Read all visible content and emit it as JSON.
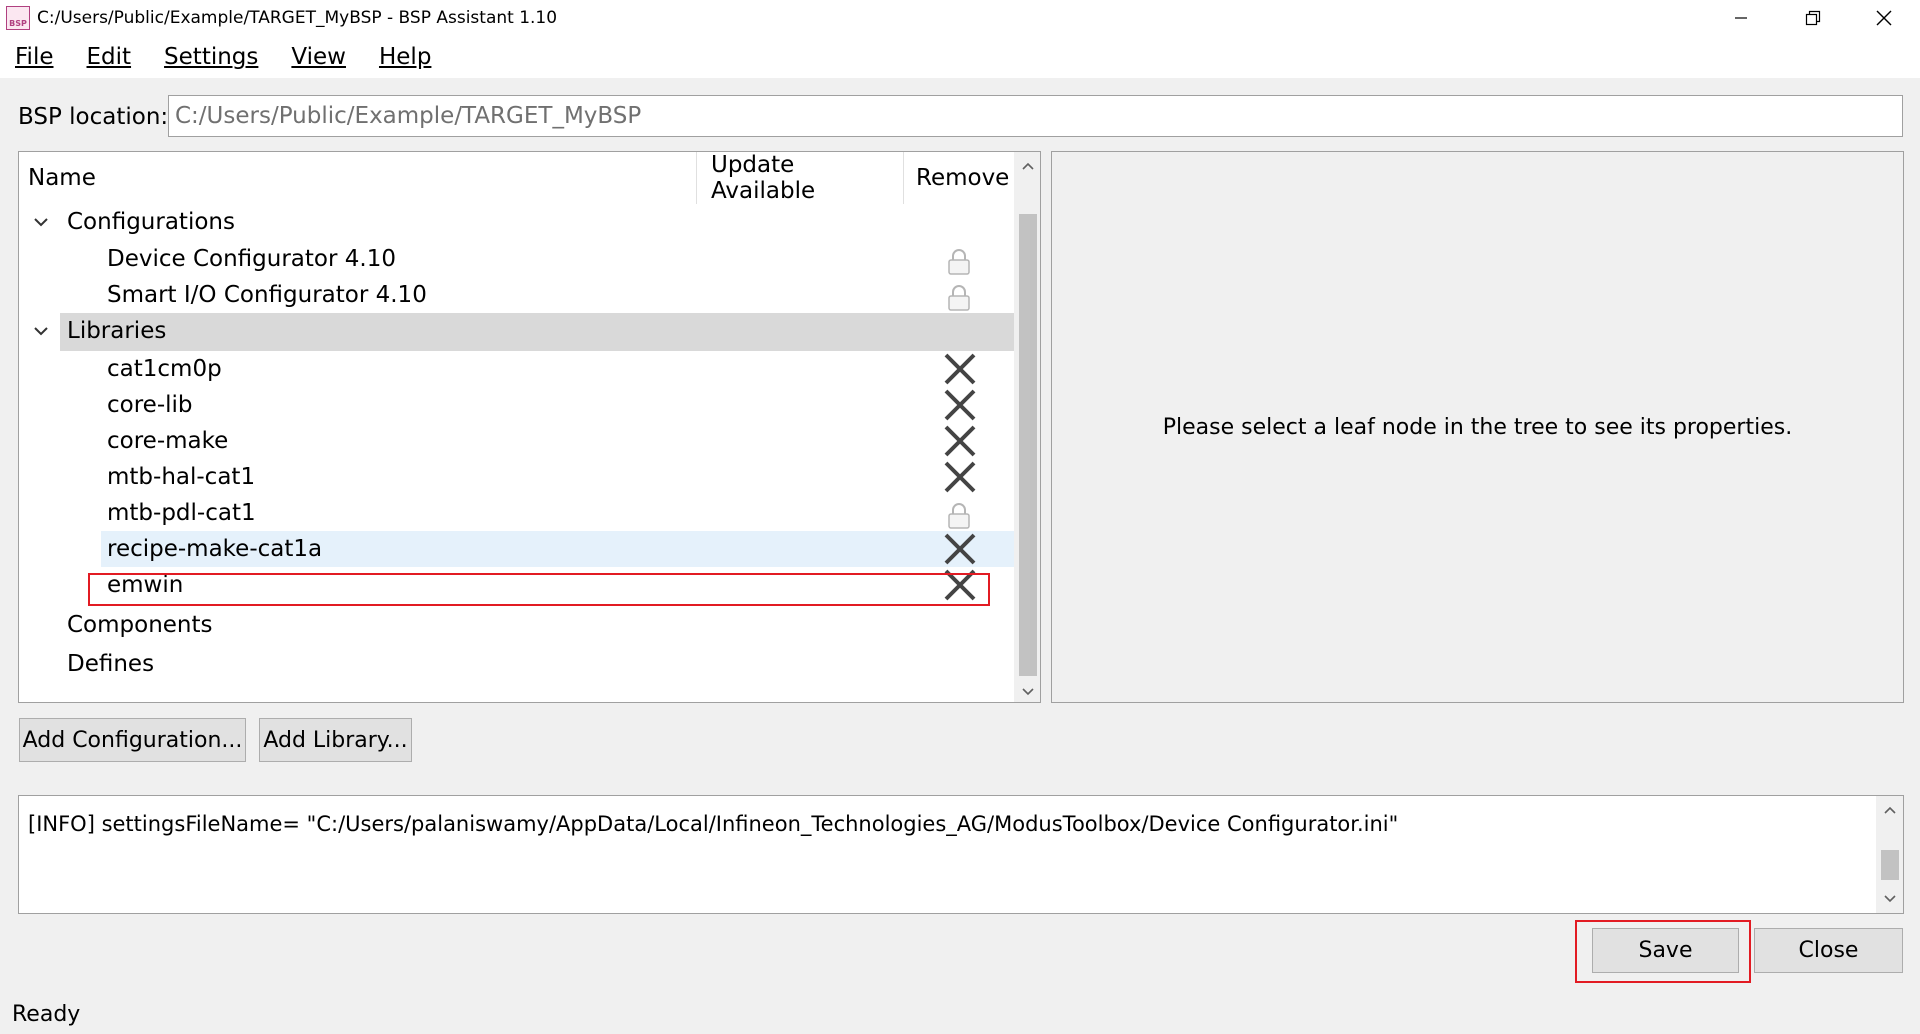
{
  "window": {
    "title": "C:/Users/Public/Example/TARGET_MyBSP - BSP Assistant 1.10",
    "app_icon_text": "BSP",
    "controls": [
      "minimize-icon",
      "restore-icon",
      "close-icon"
    ]
  },
  "menu": {
    "file": "File",
    "edit": "Edit",
    "settings": "Settings",
    "view": "View",
    "help": "Help"
  },
  "bsp_location": {
    "label": "BSP location:",
    "value": "C:/Users/Public/Example/TARGET_MyBSP"
  },
  "tree": {
    "columns": {
      "name": "Name",
      "update": "Update Available",
      "remove": "Remove"
    },
    "configurations": {
      "label": "Configurations",
      "expanded": true,
      "items": [
        {
          "name": "Device Configurator 4.10",
          "remove_icon": "lock-icon"
        },
        {
          "name": "Smart I/O Configurator 4.10",
          "remove_icon": "lock-icon"
        }
      ]
    },
    "libraries": {
      "label": "Libraries",
      "expanded": true,
      "selected": true,
      "items": [
        {
          "name": "cat1cm0p",
          "remove_icon": "remove-x-icon"
        },
        {
          "name": "core-lib",
          "remove_icon": "remove-x-icon"
        },
        {
          "name": "core-make",
          "remove_icon": "remove-x-icon"
        },
        {
          "name": "mtb-hal-cat1",
          "remove_icon": "remove-x-icon"
        },
        {
          "name": "mtb-pdl-cat1",
          "remove_icon": "lock-icon"
        },
        {
          "name": "recipe-make-cat1a",
          "remove_icon": "remove-x-icon",
          "hovered": true
        },
        {
          "name": "emwin",
          "remove_icon": "remove-x-icon",
          "highlighted": true
        }
      ]
    },
    "components": {
      "label": "Components"
    },
    "defines": {
      "label": "Defines"
    }
  },
  "properties": {
    "message": "Please select a leaf node in the tree to see its properties."
  },
  "buttons": {
    "add_configuration": "Add Configuration...",
    "add_library": "Add Library...",
    "save": "Save",
    "close": "Close"
  },
  "log": {
    "line": "[INFO] settingsFileName= \"C:/Users/palaniswamy/AppData/Local/Infineon_Technologies_AG/ModusToolbox/Device Configurator.ini\""
  },
  "status": {
    "text": "Ready"
  },
  "colors": {
    "highlight": "#e21b23",
    "selected_row": "#d9d9d9",
    "hover_row": "#e5f1fb"
  }
}
